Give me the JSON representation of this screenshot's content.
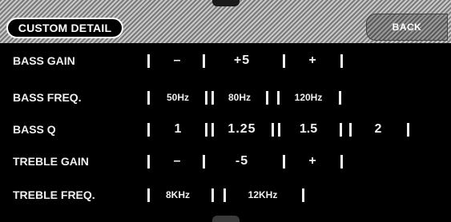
{
  "header": {
    "title": "CUSTOM DETAIL",
    "back_label": "BACK"
  },
  "rows": [
    {
      "label": "BASS GAIN",
      "dec": "–",
      "value": "+5",
      "inc": "+"
    },
    {
      "label": "BASS FREQ.",
      "options": [
        "50Hz",
        "80Hz",
        "120Hz"
      ]
    },
    {
      "label": "BASS Q",
      "options": [
        "1",
        "1.25",
        "1.5",
        "2"
      ]
    },
    {
      "label": "TREBLE GAIN",
      "dec": "–",
      "value": "-5",
      "inc": "+"
    },
    {
      "label": "TREBLE FREQ.",
      "options": [
        "8KHz",
        "12KHz"
      ]
    }
  ]
}
